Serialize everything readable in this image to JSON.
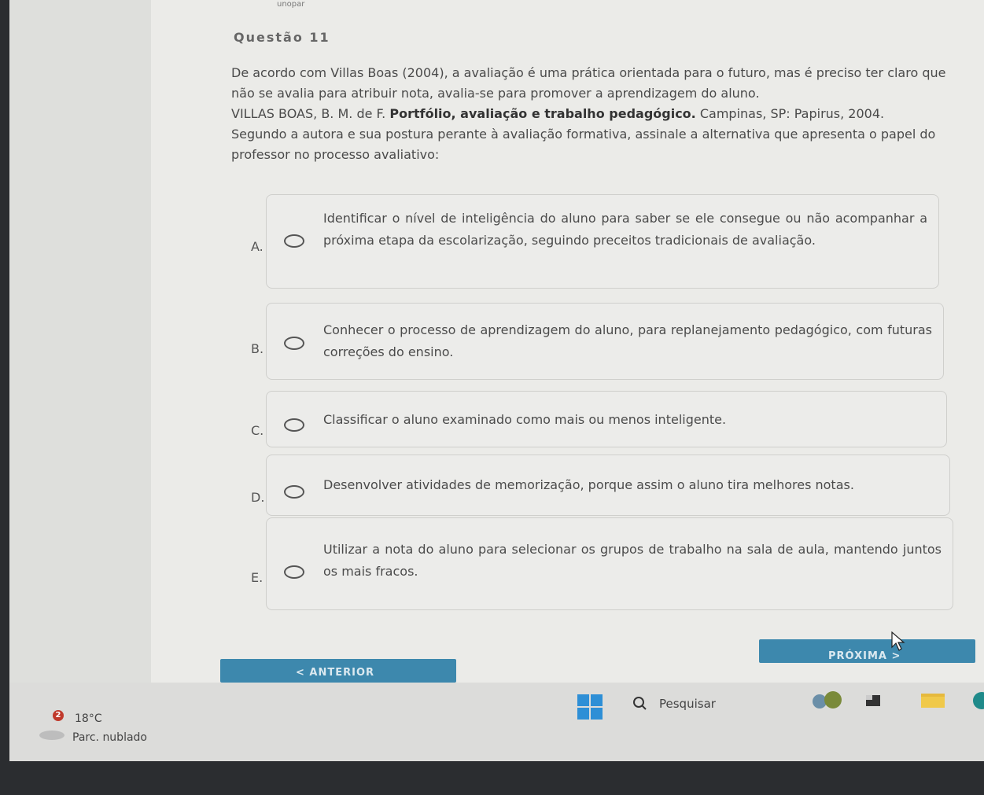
{
  "header": {
    "brand": "unopar",
    "question_label": "Questão 11"
  },
  "question": {
    "p1": "De acordo com Villas Boas (2004), a avaliação é uma prática orientada para o futuro, mas é preciso ter claro que não se avalia para atribuir nota, avalia-se para promover a aprendizagem do aluno.",
    "ref_authors": "VILLAS BOAS, B. M. de F.",
    "ref_title": "Portfólio, avaliação e trabalho pedagógico.",
    "ref_pub": "Campinas, SP: Papirus, 2004.",
    "p2": "Segundo a autora e sua postura perante à avaliação formativa, assinale a alternativa que apresenta o papel do professor no processo avaliativo:"
  },
  "options": [
    {
      "letter": "A.",
      "text": "Identificar o nível de inteligência do aluno para saber se ele consegue ou não acompanhar a próxima etapa da escolarização, seguindo preceitos tradicionais de avaliação."
    },
    {
      "letter": "B.",
      "text": "Conhecer o processo de aprendizagem do aluno, para replanejamento pedagógico, com futuras correções do ensino."
    },
    {
      "letter": "C.",
      "text": "Classificar o aluno examinado como mais ou menos inteligente."
    },
    {
      "letter": "D.",
      "text": "Desenvolver atividades de memorização, porque assim o aluno tira melhores notas."
    },
    {
      "letter": "E.",
      "text": "Utilizar a nota do aluno para selecionar os grupos de trabalho na sala de aula, mantendo juntos os mais fracos."
    }
  ],
  "nav": {
    "prev": "< ANTERIOR",
    "next": "PRÓXIMA >"
  },
  "taskbar": {
    "weather_badge": "2",
    "temperature": "18°C",
    "condition": "Parc. nublado",
    "search_placeholder": "Pesquisar"
  },
  "colors": {
    "nav_button": "#3d88ad",
    "windows_logo": "#2e8fd6",
    "weather_badge": "#c0392b"
  }
}
